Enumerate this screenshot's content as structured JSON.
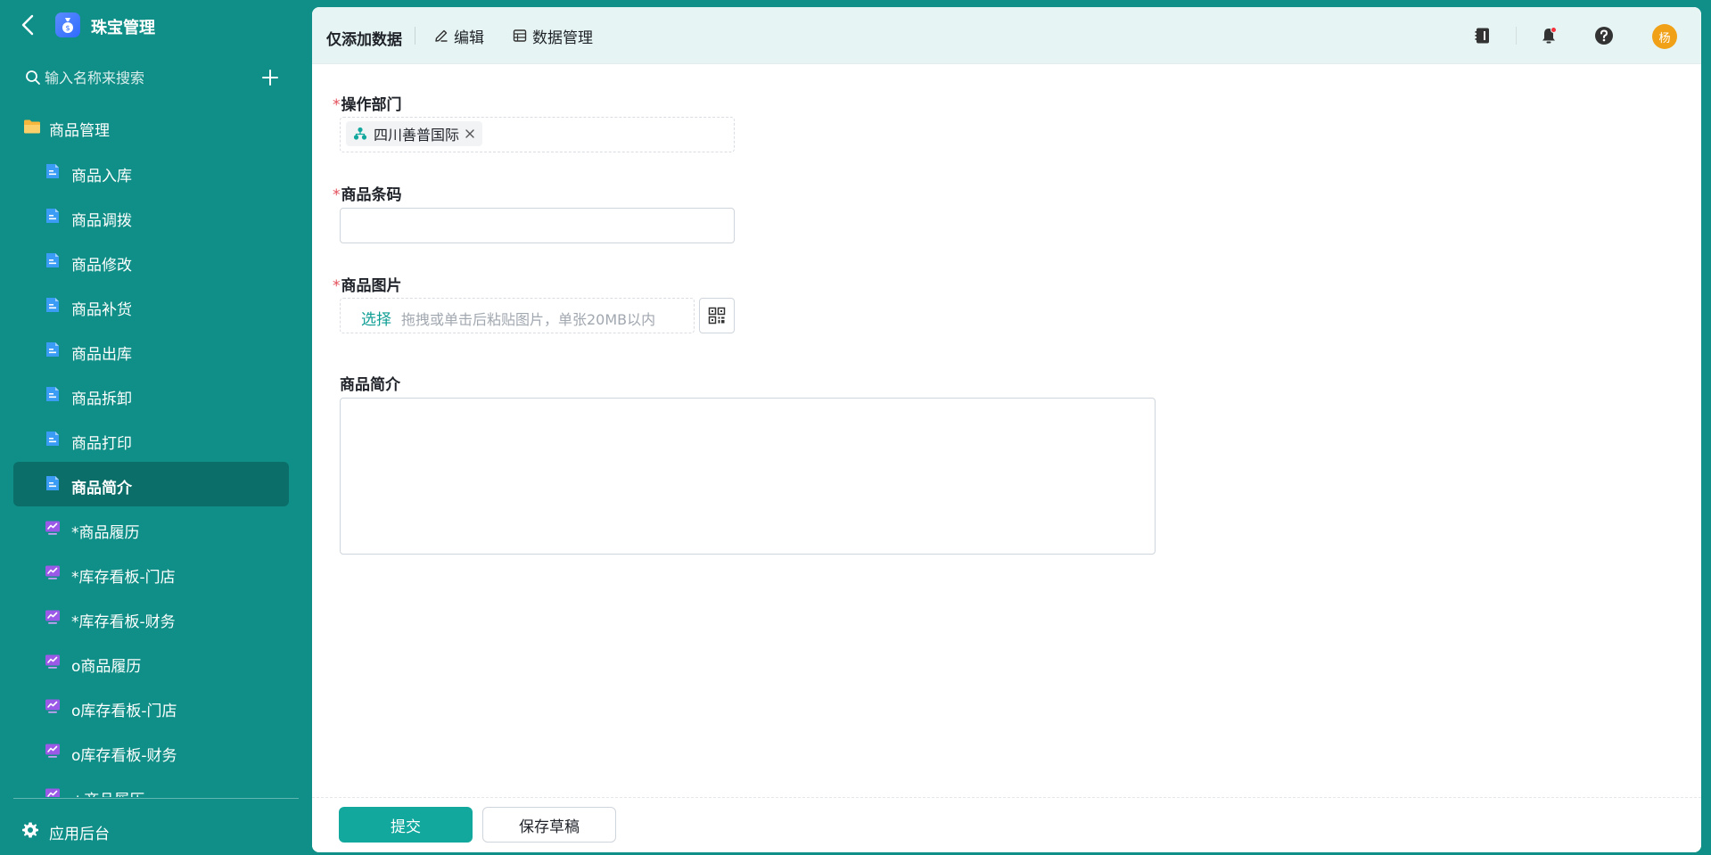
{
  "app": {
    "title": "珠宝管理",
    "search_placeholder": "输入名称来搜索"
  },
  "sidebar": {
    "group_label": "商品管理",
    "items": [
      {
        "label": "商品入库",
        "type": "form"
      },
      {
        "label": "商品调拨",
        "type": "form"
      },
      {
        "label": "商品修改",
        "type": "form"
      },
      {
        "label": "商品补货",
        "type": "form"
      },
      {
        "label": "商品出库",
        "type": "form"
      },
      {
        "label": "商品拆卸",
        "type": "form"
      },
      {
        "label": "商品打印",
        "type": "form"
      },
      {
        "label": "商品简介",
        "type": "form",
        "active": true
      },
      {
        "label": "*商品履历",
        "type": "dashboard"
      },
      {
        "label": "*库存看板-门店",
        "type": "dashboard"
      },
      {
        "label": "*库存看板-财务",
        "type": "dashboard"
      },
      {
        "label": "o商品履历",
        "type": "dashboard"
      },
      {
        "label": "o库存看板-门店",
        "type": "dashboard"
      },
      {
        "label": "o库存看板-财务",
        "type": "dashboard"
      },
      {
        "label": "+商品履历",
        "type": "dashboard"
      }
    ],
    "footer_label": "应用后台"
  },
  "topbar": {
    "title": "仅添加数据",
    "edit_label": "编辑",
    "data_label": "数据管理",
    "avatar_text": "杨"
  },
  "form": {
    "dept_label": "操作部门",
    "dept_value": "四川善普国际",
    "barcode_label": "商品条码",
    "barcode_value": "",
    "image_label": "商品图片",
    "image_choose": "选择",
    "image_hint": "拖拽或单击后粘贴图片，单张20MB以内",
    "intro_label": "商品简介",
    "intro_value": ""
  },
  "footer": {
    "submit_label": "提交",
    "draft_label": "保存草稿"
  },
  "colors": {
    "sidebar_bg": "#0f8f87",
    "active_bg": "#0b6e68",
    "primary": "#13a89e",
    "required": "#e34d59",
    "form_icon": "#3b9cf5",
    "dashboard_icon": "#9b59e8"
  }
}
